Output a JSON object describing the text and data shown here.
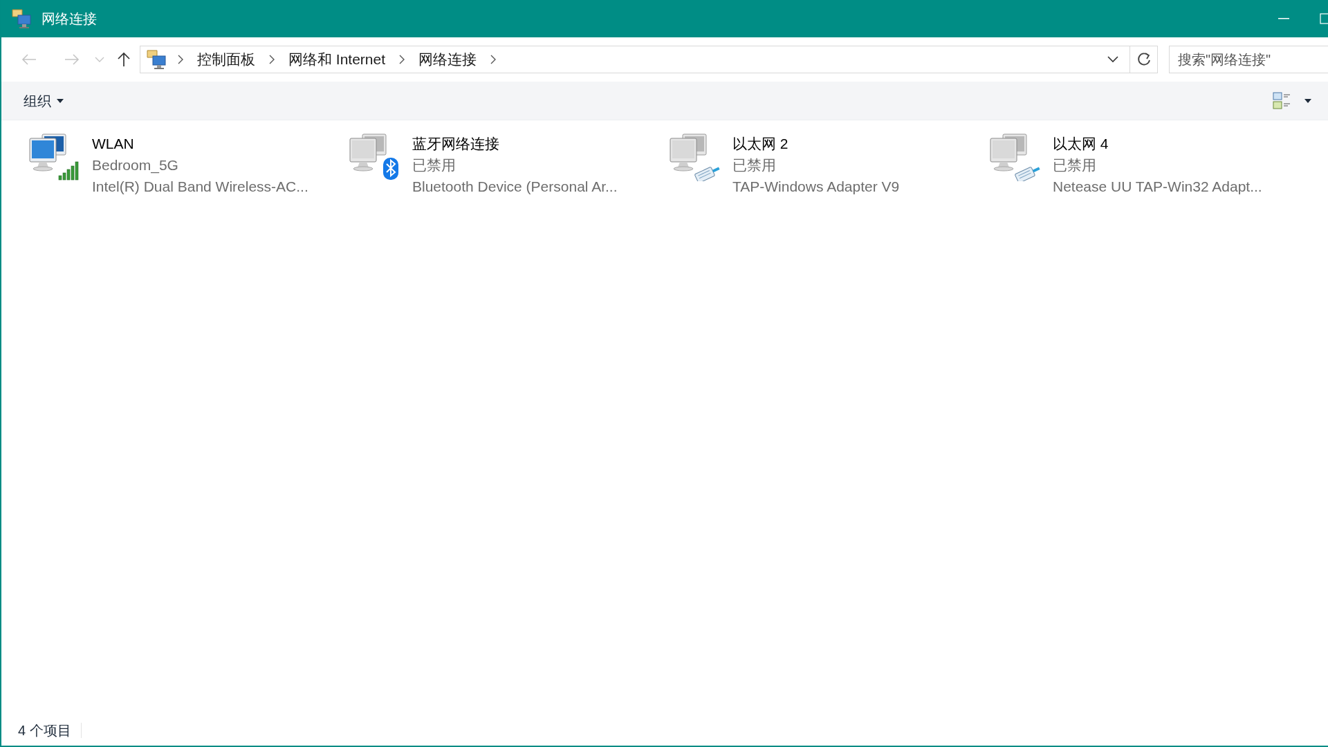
{
  "window": {
    "title": "网络连接"
  },
  "address_bar": {
    "breadcrumbs": [
      "控制面板",
      "网络和 Internet",
      "网络连接"
    ]
  },
  "search": {
    "placeholder": "搜索\"网络连接\""
  },
  "toolbar": {
    "organize": "组织"
  },
  "connections": [
    {
      "kind": "wifi",
      "name": "WLAN",
      "status": "Bedroom_5G",
      "device": "Intel(R) Dual Band Wireless-AC...",
      "disabled": false
    },
    {
      "kind": "bluetooth",
      "name": "蓝牙网络连接",
      "status": "已禁用",
      "device": "Bluetooth Device (Personal Ar...",
      "disabled": true
    },
    {
      "kind": "ethernet",
      "name": "以太网 2",
      "status": "已禁用",
      "device": "TAP-Windows Adapter V9",
      "disabled": true
    },
    {
      "kind": "ethernet",
      "name": "以太网 4",
      "status": "已禁用",
      "device": "Netease UU TAP-Win32 Adapt...",
      "disabled": true
    }
  ],
  "status_bar": {
    "count": "4 个项目"
  }
}
